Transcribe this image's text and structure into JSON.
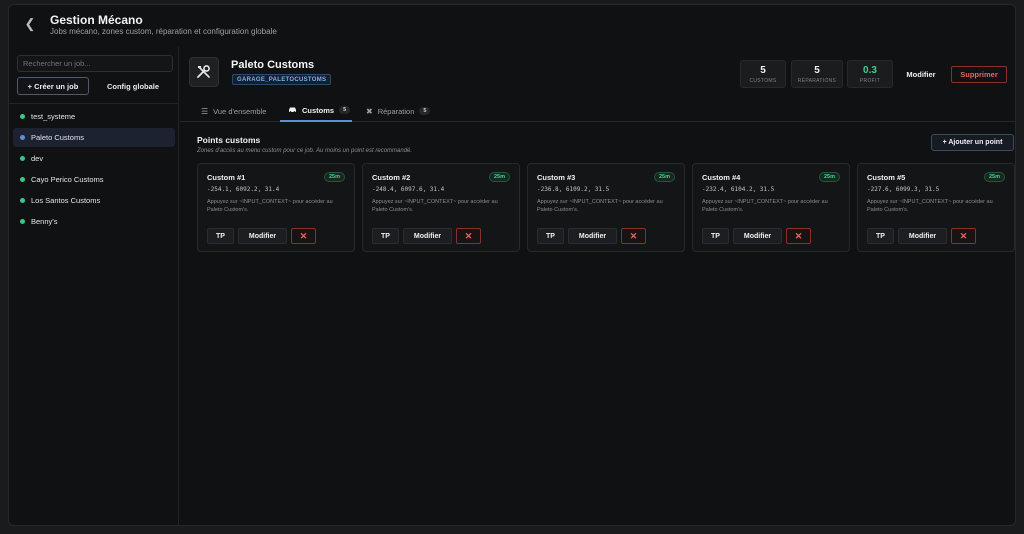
{
  "header": {
    "title": "Gestion Mécano",
    "subtitle": "Jobs mécano, zones custom, réparation et configuration globale"
  },
  "sidebar": {
    "search_placeholder": "Rechercher un job...",
    "create_label": "+ Créer un job",
    "config_label": "Config globale",
    "jobs": [
      {
        "label": "test_systeme",
        "dot_color": "#37c98a",
        "active": false
      },
      {
        "label": "Paleto Customs",
        "dot_color": "#5b8fd8",
        "active": true
      },
      {
        "label": "dev",
        "dot_color": "#37c98a",
        "active": false
      },
      {
        "label": "Cayo Perico Customs",
        "dot_color": "#37c98a",
        "active": false
      },
      {
        "label": "Los Santos Customs",
        "dot_color": "#37c98a",
        "active": false
      },
      {
        "label": "Benny's",
        "dot_color": "#37c98a",
        "active": false
      }
    ]
  },
  "garage": {
    "name": "Paleto Customs",
    "tag": "GARAGE_PALETOCUSTOMS",
    "icon": "wrench-screwdriver-icon",
    "stats": [
      {
        "value": "5",
        "label": "CUSTOMS"
      },
      {
        "value": "5",
        "label": "RÉPARATIONS"
      },
      {
        "value": "0.3",
        "label": "PROFIT"
      }
    ],
    "edit_label": "Modifier",
    "delete_label": "Supprimer"
  },
  "tabs": [
    {
      "label": "Vue d'ensemble",
      "badge": "",
      "icon": "sliders-icon",
      "active": false
    },
    {
      "label": "Customs",
      "badge": "5",
      "icon": "car-icon",
      "active": true
    },
    {
      "label": "Réparation",
      "badge": "5",
      "icon": "tools-icon",
      "active": false
    }
  ],
  "section": {
    "title": "Points customs",
    "description": "Zones d'accès au menu custom pour ce job. Au moins un point est recommandé.",
    "add_label": "+ Ajouter un point"
  },
  "cards": [
    {
      "title": "Custom #1",
      "distance": "25m",
      "coords": "-254.1, 6092.2, 31.4",
      "hint": "Appuyez sur ~INPUT_CONTEXT~ pour accéder au Paleto Custom's.",
      "tp": "TP",
      "edit": "Modifier",
      "remove": "✕"
    },
    {
      "title": "Custom #2",
      "distance": "25m",
      "coords": "-248.4, 6097.6, 31.4",
      "hint": "Appuyez sur ~INPUT_CONTEXT~ pour accéder au Paleto Custom's.",
      "tp": "TP",
      "edit": "Modifier",
      "remove": "✕"
    },
    {
      "title": "Custom #3",
      "distance": "25m",
      "coords": "-236.8, 6109.2, 31.5",
      "hint": "Appuyez sur ~INPUT_CONTEXT~ pour accéder au Paleto Custom's.",
      "tp": "TP",
      "edit": "Modifier",
      "remove": "✕"
    },
    {
      "title": "Custom #4",
      "distance": "25m",
      "coords": "-232.4, 6104.2, 31.5",
      "hint": "Appuyez sur ~INPUT_CONTEXT~ pour accéder au Paleto Custom's.",
      "tp": "TP",
      "edit": "Modifier",
      "remove": "✕"
    },
    {
      "title": "Custom #5",
      "distance": "25m",
      "coords": "-227.6, 6099.3, 31.5",
      "hint": "Appuyez sur ~INPUT_CONTEXT~ pour accéder au Paleto Custom's.",
      "tp": "TP",
      "edit": "Modifier",
      "remove": "✕"
    }
  ]
}
